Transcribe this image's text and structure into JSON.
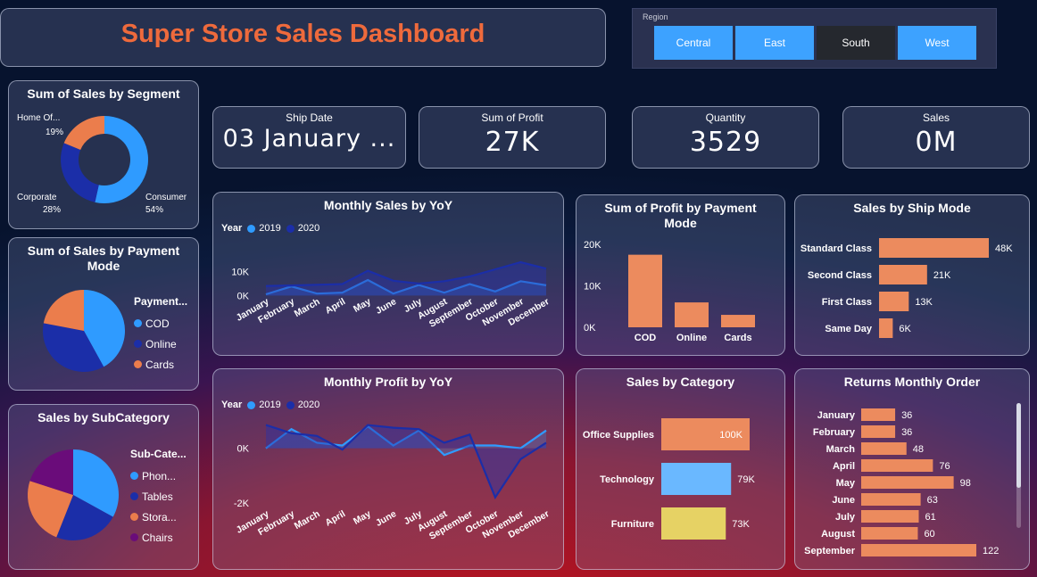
{
  "header": {
    "title": "Super Store Sales Dashboard"
  },
  "region": {
    "label": "Region",
    "options": [
      "Central",
      "East",
      "South",
      "West"
    ],
    "selected": "South"
  },
  "kpis": {
    "ship_date": {
      "label": "Ship Date",
      "value": "03 January ..."
    },
    "profit": {
      "label": "Sum of Profit",
      "value": "27K"
    },
    "quantity": {
      "label": "Quantity",
      "value": "3529"
    },
    "sales": {
      "label": "Sales",
      "value": "0M"
    }
  },
  "colors": {
    "accent": "#ee6a3c",
    "blue": "#2f9bff",
    "dark_blue": "#1b2ea8",
    "orange": "#eb7d4c",
    "purple": "#6a0c7a",
    "yellow": "#e6d264",
    "light_blue": "#6ab8ff",
    "bar": "#ec8b5e"
  },
  "chart_data": [
    {
      "id": "segment",
      "type": "pie",
      "title": "Sum of Sales by Segment",
      "categories": [
        "Consumer",
        "Corporate",
        "Home Of..."
      ],
      "values": [
        54,
        28,
        19
      ],
      "labels": [
        "54%",
        "28%",
        "19%"
      ]
    },
    {
      "id": "payment_sales",
      "type": "pie",
      "title": "Sum of Sales by Payment Mode",
      "legend_title": "Payment...",
      "categories": [
        "COD",
        "Online",
        "Cards"
      ],
      "values": [
        42,
        36,
        22
      ]
    },
    {
      "id": "subcategory",
      "type": "pie",
      "title": "Sales by SubCategory",
      "legend_title": "Sub-Cate...",
      "categories": [
        "Phon...",
        "Tables",
        "Stora...",
        "Chairs"
      ],
      "values": [
        33,
        23,
        24,
        20
      ]
    },
    {
      "id": "monthly_sales",
      "type": "area",
      "title": "Monthly Sales by YoY",
      "legend_title": "Year",
      "categories": [
        "January",
        "February",
        "March",
        "April",
        "May",
        "June",
        "July",
        "August",
        "September",
        "October",
        "November",
        "December"
      ],
      "yticks": [
        "0K",
        "10K"
      ],
      "ylim": [
        -1000,
        14000
      ],
      "series": [
        {
          "name": "2019",
          "values": [
            500,
            3800,
            800,
            1200,
            6500,
            800,
            4400,
            1200,
            4800,
            1700,
            6000,
            4300
          ]
        },
        {
          "name": "2020",
          "values": [
            4000,
            4200,
            4500,
            4800,
            10400,
            6200,
            5000,
            6000,
            8000,
            11000,
            14000,
            11300
          ]
        }
      ]
    },
    {
      "id": "monthly_profit",
      "type": "area",
      "title": "Monthly Profit by YoY",
      "legend_title": "Year",
      "categories": [
        "January",
        "February",
        "March",
        "April",
        "May",
        "June",
        "July",
        "August",
        "September",
        "October",
        "November",
        "December"
      ],
      "yticks": [
        "0K",
        "-2K"
      ],
      "ylim": [
        -2400,
        1000
      ],
      "series": [
        {
          "name": "2019",
          "values": [
            0,
            700,
            200,
            100,
            800,
            100,
            650,
            -250,
            100,
            100,
            0,
            650
          ]
        },
        {
          "name": "2020",
          "values": [
            850,
            550,
            450,
            -50,
            850,
            750,
            700,
            200,
            500,
            -1800,
            -400,
            200
          ]
        }
      ]
    },
    {
      "id": "profit_payment",
      "type": "bar",
      "title": "Sum of Profit by Payment Mode",
      "categories": [
        "COD",
        "Online",
        "Cards"
      ],
      "values": [
        17500,
        6000,
        3000
      ],
      "yticks": [
        "20K",
        "10K",
        "0K"
      ],
      "ylim": [
        0,
        20000
      ]
    },
    {
      "id": "ship_mode",
      "type": "bar",
      "title": "Sales by Ship Mode",
      "categories": [
        "Standard Class",
        "Second Class",
        "First Class",
        "Same Day"
      ],
      "values": [
        48,
        21,
        13,
        6
      ],
      "labels": [
        "48K",
        "21K",
        "13K",
        "6K"
      ]
    },
    {
      "id": "category",
      "type": "bar",
      "title": "Sales by Category",
      "categories": [
        "Office Supplies",
        "Technology",
        "Furniture"
      ],
      "values": [
        100,
        79,
        73
      ],
      "labels": [
        "100K",
        "79K",
        "73K"
      ]
    },
    {
      "id": "returns",
      "type": "bar",
      "title": "Returns Monthly Order",
      "categories": [
        "January",
        "February",
        "March",
        "April",
        "May",
        "June",
        "July",
        "August",
        "September"
      ],
      "values": [
        36,
        36,
        48,
        76,
        98,
        63,
        61,
        60,
        122
      ],
      "labels": [
        "36",
        "36",
        "48",
        "76",
        "98",
        "63",
        "61",
        "60",
        "122"
      ]
    }
  ]
}
